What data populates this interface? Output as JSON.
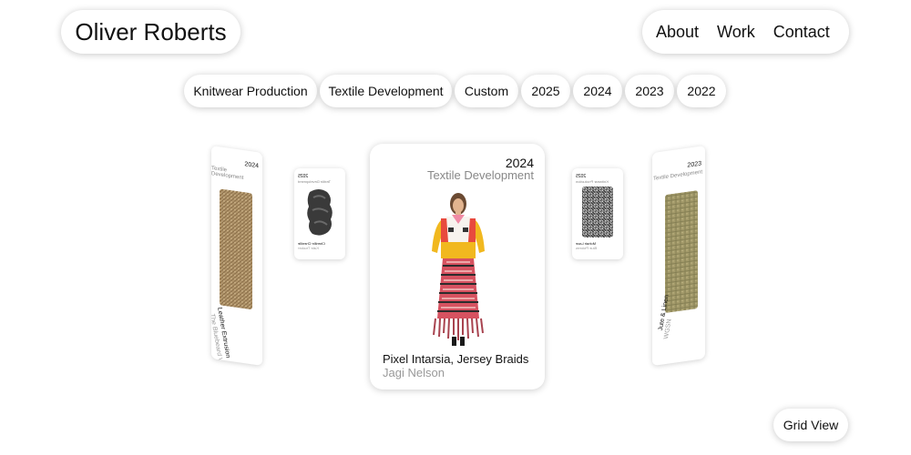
{
  "brand": {
    "name": "Oliver Roberts"
  },
  "nav": {
    "items": [
      "About",
      "Work",
      "Contact"
    ]
  },
  "filters": [
    "Knitwear Production",
    "Textile Development",
    "Custom",
    "2025",
    "2024",
    "2023",
    "2022"
  ],
  "cards": {
    "far_left": {
      "year": "2024",
      "category": "Textile Development",
      "title": "Leather Extrusion",
      "author": "The Bluebeard Vendor"
    },
    "near_left": {
      "year": "2025",
      "category": "Textile Development",
      "title": "Chenille Chenille",
      "author": "Kate Trucker"
    },
    "center": {
      "year": "2024",
      "category": "Textile Development",
      "title": "Pixel Intarsia, Jersey Braids",
      "author": "Jagi Nelson"
    },
    "near_right": {
      "year": "2025",
      "category": "Knitwear Production",
      "title": "Mohair Lace",
      "author": "Blue Pickens"
    },
    "far_right": {
      "year": "2023",
      "category": "Textile Development",
      "title": "Jute & Linen",
      "author": "WGSN"
    }
  },
  "grid_view": {
    "label": "Grid View"
  },
  "colors": {
    "background": "#ffffff",
    "muted_text": "#888888",
    "shadow": "rgba(0,0,0,0.2)"
  }
}
